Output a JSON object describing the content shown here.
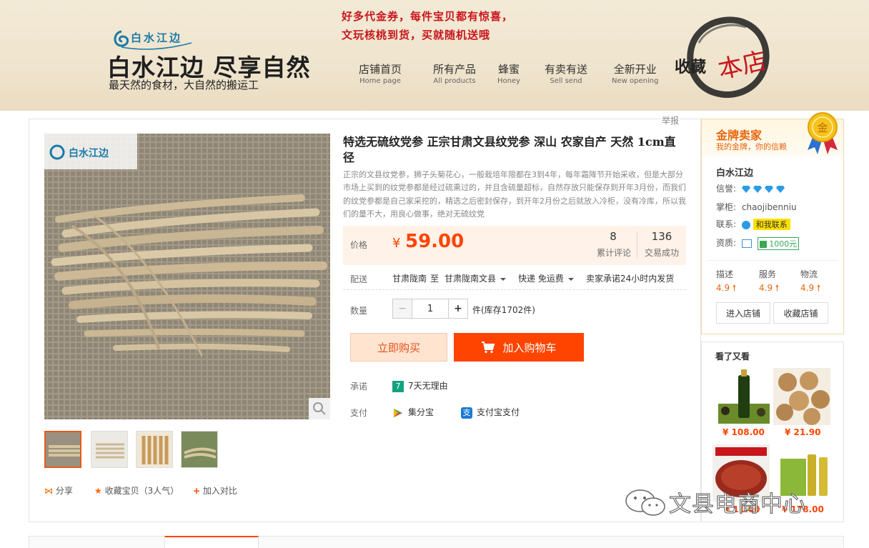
{
  "banner": {
    "promo_line1": "好多代金券，每件宝贝都有惊喜，",
    "promo_line2": "文玩核桃到货，买就随机送哦",
    "logo_text": "白水江边",
    "slogan": "白水江边 尽享自然",
    "sub_slogan": "最天然的食材，大自然的搬运工",
    "nav": [
      {
        "zh": "店铺首页",
        "en": "Home page"
      },
      {
        "zh": "所有产品",
        "en": "All products"
      },
      {
        "zh": "蜂蜜",
        "en": "Honey"
      },
      {
        "zh": "有卖有送",
        "en": "Sell send"
      },
      {
        "zh": "全新开业",
        "en": "New opening"
      }
    ],
    "favorite_label": "收藏",
    "favorite_stamp": "本店"
  },
  "report_label": "举报",
  "product": {
    "title": "特选无硫纹党参 正宗甘肃文县纹党参 深山 农家自产 天然 1cm直径",
    "description": "正宗的文县纹党参，狮子头菊花心，一般栽培年限都在3到4年，每年霜降节开始采收，但是大部分市场上买到的纹党参都是经过硫熏过的，并且含硫量超标，自然存放只能保存到开年3月份，而我们的纹党参都是自己家采挖的，精选之后密封保存，到开年2月份之后就放入冷柜，没有冷库，所以我们的量不大，用良心做事，绝对无硫纹党",
    "image_logo": "白水江边",
    "price_label": "价格",
    "price_currency": "¥",
    "price": "59.00",
    "reviews_count": "8",
    "reviews_label": "累计评论",
    "sales_count": "136",
    "sales_label": "交易成功",
    "delivery_label": "配送",
    "delivery_from": "甘肃陇南",
    "delivery_to_word": "至",
    "delivery_to": "甘肃陇南文县",
    "shipping": "快递 免运费",
    "shipping_promise": "卖家承诺24小时内发货",
    "qty_label": "数量",
    "qty_value": "1",
    "qty_minus": "−",
    "qty_plus": "+",
    "stock_text": "件(库存1702件)",
    "buy_now": "立即购买",
    "add_to_cart": "加入购物车",
    "promise_label": "承诺",
    "promise_badge": "7",
    "promise_text": "7天无理由",
    "payment_label": "支付",
    "pay_methods": [
      "集分宝",
      "支付宝支付"
    ],
    "share": "分享",
    "collect": "收藏宝贝（3人气）",
    "compare": "加入对比"
  },
  "seller": {
    "badge_title": "金牌卖家",
    "badge_sub": "我的金牌，你的信赖",
    "medal_char": "金",
    "shop_name": "白水江边",
    "credit_label": "信誉:",
    "keeper_label": "掌柜:",
    "keeper": "chaojibenniu",
    "contact_label": "联系:",
    "contact_btn": "和我联系",
    "qual_label": "资质:",
    "deposit": "1000元",
    "scores": [
      {
        "label": "描述",
        "value": "4.9"
      },
      {
        "label": "服务",
        "value": "4.9"
      },
      {
        "label": "物流",
        "value": "4.9"
      }
    ],
    "enter_shop": "进入店铺",
    "fav_shop": "收藏店铺"
  },
  "recommend": {
    "title": "看了又看",
    "items": [
      {
        "price": "¥ 108.00"
      },
      {
        "price": "¥ 21.90"
      },
      {
        "price": "¥ 11.00"
      },
      {
        "price": "¥ 178.00"
      }
    ]
  },
  "watermark": "文县电商中心",
  "colors": {
    "accent": "#ff4400",
    "gold": "#e8650c",
    "promo_red": "#c8161d"
  }
}
